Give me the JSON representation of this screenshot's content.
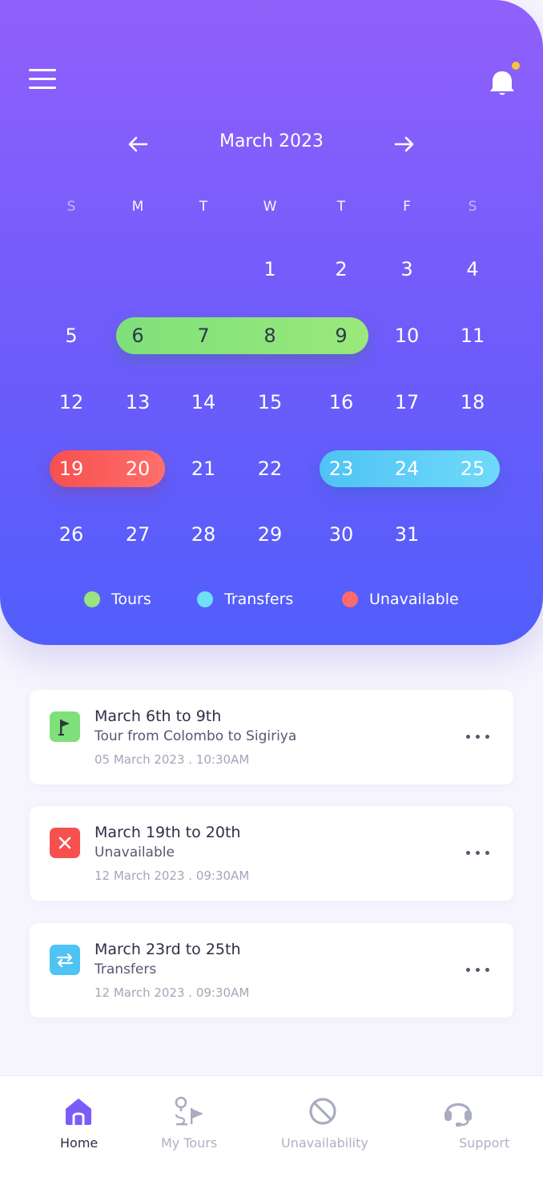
{
  "calendar": {
    "month_title": "March 2023",
    "weekdays": [
      "S",
      "M",
      "T",
      "W",
      "T",
      "F",
      "S"
    ],
    "days": [
      "1",
      "2",
      "3",
      "4",
      "5",
      "6",
      "7",
      "8",
      "9",
      "10",
      "11",
      "12",
      "13",
      "14",
      "15",
      "16",
      "17",
      "18",
      "19",
      "20",
      "21",
      "22",
      "23",
      "24",
      "25",
      "26",
      "27",
      "28",
      "29",
      "30",
      "31"
    ],
    "first_weekday_index": 3,
    "ranges": [
      {
        "type": "tours",
        "start": 6,
        "end": 9,
        "color": "#8de37b"
      },
      {
        "type": "unavailable",
        "start": 19,
        "end": 20,
        "color": "#f9585a"
      },
      {
        "type": "transfers",
        "start": 23,
        "end": 25,
        "color": "#5ccdf7"
      }
    ]
  },
  "legend": [
    {
      "label": "Tours",
      "color": "#9be37c"
    },
    {
      "label": "Transfers",
      "color": "#6edff8"
    },
    {
      "label": "Unavailable",
      "color": "#fb6b6b"
    }
  ],
  "events": [
    {
      "title": "March 6th to 9th",
      "subtitle": "Tour from Colombo to Sigiriya",
      "date": "05 March 2023 .  10:30AM",
      "icon": "flag-icon",
      "icon_color": "#7ee07a"
    },
    {
      "title": "March 19th to 20th",
      "subtitle": "Unavailable",
      "date": "12 March 2023 .  09:30AM",
      "icon": "close-icon",
      "icon_color": "#f6504f"
    },
    {
      "title": "March 23rd to 25th",
      "subtitle": "Transfers",
      "date": "12 March 2023 .  09:30AM",
      "icon": "swap-icon",
      "icon_color": "#4fc3f4"
    }
  ],
  "nav": [
    {
      "label": "Home",
      "icon": "home-icon",
      "active": true
    },
    {
      "label": "My Tours",
      "icon": "route-icon",
      "active": false
    },
    {
      "label": "Unavailability",
      "icon": "block-icon",
      "active": false
    },
    {
      "label": "Support",
      "icon": "headset-icon",
      "active": false
    }
  ],
  "colors": {
    "accent": "#7b5cfb",
    "notification_dot": "#f8c43a"
  }
}
